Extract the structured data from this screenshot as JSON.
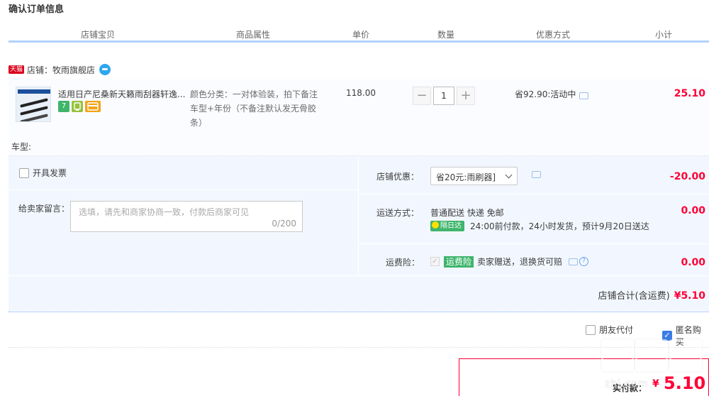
{
  "page": {
    "title": "确认订单信息"
  },
  "table_header": {
    "shop_item": "店铺宝贝",
    "attributes": "商品属性",
    "unit_price": "单价",
    "quantity": "数量",
    "discount": "优惠方式",
    "subtotal": "小计"
  },
  "shop": {
    "badge": "天猫",
    "label": "店铺：牧雨旗舰店"
  },
  "item": {
    "title": "适用日产尼桑新天籁雨刮器轩逸...",
    "badges": [
      "7",
      "",
      ""
    ],
    "sku": "颜色分类：一对体验装，拍下备注车型+年份（不备注默认发无骨胶条）",
    "price": "118.00",
    "quantity": "1",
    "qty_minus": "−",
    "qty_plus": "+",
    "promo": "省92.90:活动中",
    "subtotal": "25.10",
    "cartype_label": "车型:"
  },
  "invoice": {
    "label": "开具发票"
  },
  "message": {
    "label": "给卖家留言：",
    "placeholder": "选填，请先和商家协商一致，付款后商家可见",
    "counter": "0/200"
  },
  "shop_discount": {
    "label": "店铺优惠：",
    "selected": "省20元:雨刷器]",
    "amount": "-20.00"
  },
  "shipping": {
    "label": "运送方式：",
    "method": "普通配送 快递 免邮",
    "tag": "隔日达",
    "detail": "24:00前付款，24小时发货，预计9月20日送达",
    "amount": "0.00"
  },
  "insurance": {
    "label": "运费险：",
    "tag": "运费险",
    "detail": "卖家赠送，退换货可赔",
    "amount": "0.00"
  },
  "shop_total": {
    "label": "店铺合计(含运费)",
    "value": "¥5.10"
  },
  "options": {
    "friend_pay": "朋友代付",
    "anonymous": "匿名购买"
  },
  "payment": {
    "label": "实付款：",
    "symbol": "¥",
    "value": "5.10"
  },
  "watermark": {
    "text": "zhi.com"
  },
  "colors": {
    "accent": "#ff0036",
    "header_rule": "#b2d1ff",
    "panel_bg": "#f2f7ff",
    "green_tag": "#3eb56b"
  }
}
